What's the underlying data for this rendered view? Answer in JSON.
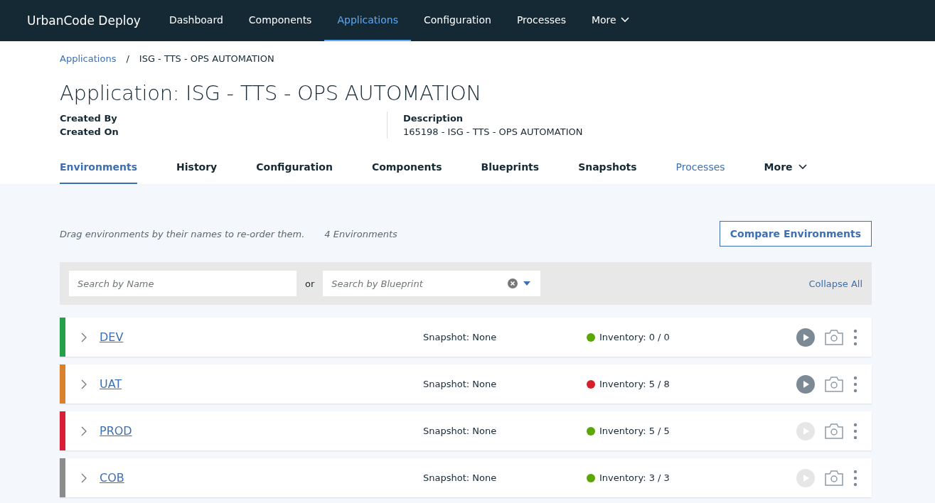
{
  "header": {
    "brand": "UrbanCode Deploy",
    "nav": [
      {
        "label": "Dashboard",
        "selected": false
      },
      {
        "label": "Components",
        "selected": false
      },
      {
        "label": "Applications",
        "selected": true
      },
      {
        "label": "Configuration",
        "selected": false
      },
      {
        "label": "Processes",
        "selected": false
      },
      {
        "label": "More",
        "selected": false,
        "kind": "menu"
      }
    ]
  },
  "breadcrumb": {
    "link": "Applications",
    "separator": "/",
    "current": "ISG - TTS - OPS AUTOMATION"
  },
  "title": "Application: ISG - TTS - OPS AUTOMATION",
  "details": {
    "created_by_label": "Created By",
    "created_on_label": "Created On",
    "description_label": "Description",
    "description": "165198 - ISG - TTS - OPS AUTOMATION"
  },
  "tabs": [
    {
      "label": "Environments",
      "selected": true
    },
    {
      "label": "History",
      "selected": false
    },
    {
      "label": "Configuration",
      "selected": false
    },
    {
      "label": "Components",
      "selected": false
    },
    {
      "label": "Blueprints",
      "selected": false
    },
    {
      "label": "Snapshots",
      "selected": false
    },
    {
      "label": "Processes",
      "selected": false,
      "kind": "link"
    },
    {
      "label": "More",
      "selected": false,
      "kind": "menu"
    }
  ],
  "hint": "Drag environments by their names to re-order them.",
  "count": "4 Environments",
  "compare_button": "Compare Environments",
  "filters": {
    "name_placeholder": "Search by Name",
    "or": "or",
    "blueprint_placeholder": "Search by Blueprint",
    "collapse": "Collapse All"
  },
  "environments": [
    {
      "name": "DEV",
      "color": "#24a148",
      "snapshot": "Snapshot: None",
      "inventory": {
        "text": "Inventory: 0 / 0",
        "color": "#5aa700"
      },
      "run_disabled": false
    },
    {
      "name": "UAT",
      "color": "#d9822b",
      "snapshot": "Snapshot: None",
      "inventory": {
        "text": "Inventory: 5 / 8",
        "color": "#da1e28"
      },
      "run_disabled": false
    },
    {
      "name": "PROD",
      "color": "#da1e37",
      "snapshot": "Snapshot: None",
      "inventory": {
        "text": "Inventory: 5 / 5",
        "color": "#5aa700"
      },
      "run_disabled": true
    },
    {
      "name": "COB",
      "color": "#8c8c8c",
      "snapshot": "Snapshot: None",
      "inventory": {
        "text": "Inventory: 3 / 3",
        "color": "#5aa700"
      },
      "run_disabled": true
    }
  ]
}
